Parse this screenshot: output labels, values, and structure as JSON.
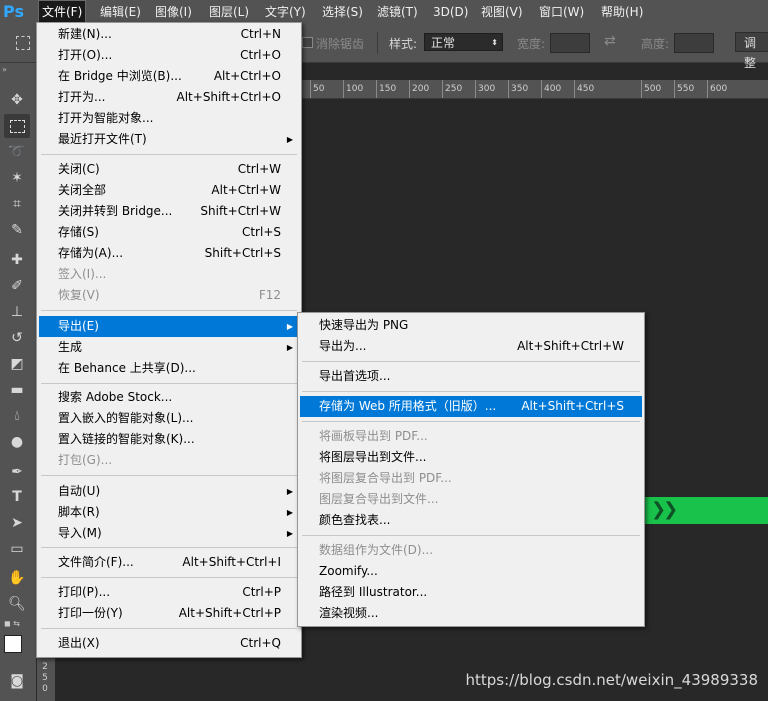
{
  "app": {
    "logo": "Ps",
    "menubar": [
      "文件(F)",
      "编辑(E)",
      "图像(I)",
      "图层(L)",
      "文字(Y)",
      "选择(S)",
      "滤镜(T)",
      "3D(D)",
      "视图(V)",
      "窗口(W)",
      "帮助(H)"
    ],
    "active_menu": "文件(F)"
  },
  "options": {
    "antialias_label": "消除锯齿",
    "style_label": "样式:",
    "style_value": "正常",
    "width_label": "宽度:",
    "height_label": "高度:",
    "adjust_button": "调整"
  },
  "ruler": {
    "ticks": [
      "50",
      "100",
      "150",
      "200",
      "250",
      "300",
      "350",
      "400",
      "450",
      "500",
      "550",
      "600"
    ],
    "vertical": [
      "2",
      "5",
      "0"
    ]
  },
  "file_menu": {
    "items": [
      {
        "label": "新建(N)...",
        "shortcut": "Ctrl+N"
      },
      {
        "label": "打开(O)...",
        "shortcut": "Ctrl+O"
      },
      {
        "label": "在 Bridge 中浏览(B)...",
        "shortcut": "Alt+Ctrl+O"
      },
      {
        "label": "打开为...",
        "shortcut": "Alt+Shift+Ctrl+O"
      },
      {
        "label": "打开为智能对象...",
        "shortcut": ""
      },
      {
        "label": "最近打开文件(T)",
        "shortcut": ""
      },
      {
        "label": "关闭(C)",
        "shortcut": "Ctrl+W"
      },
      {
        "label": "关闭全部",
        "shortcut": "Alt+Ctrl+W"
      },
      {
        "label": "关闭并转到 Bridge...",
        "shortcut": "Shift+Ctrl+W"
      },
      {
        "label": "存储(S)",
        "shortcut": "Ctrl+S"
      },
      {
        "label": "存储为(A)...",
        "shortcut": "Shift+Ctrl+S"
      },
      {
        "label": "签入(I)...",
        "shortcut": ""
      },
      {
        "label": "恢复(V)",
        "shortcut": "F12"
      },
      {
        "label": "导出(E)",
        "shortcut": ""
      },
      {
        "label": "生成",
        "shortcut": ""
      },
      {
        "label": "在 Behance 上共享(D)...",
        "shortcut": ""
      },
      {
        "label": "搜索 Adobe Stock...",
        "shortcut": ""
      },
      {
        "label": "置入嵌入的智能对象(L)...",
        "shortcut": ""
      },
      {
        "label": "置入链接的智能对象(K)...",
        "shortcut": ""
      },
      {
        "label": "打包(G)...",
        "shortcut": ""
      },
      {
        "label": "自动(U)",
        "shortcut": ""
      },
      {
        "label": "脚本(R)",
        "shortcut": ""
      },
      {
        "label": "导入(M)",
        "shortcut": ""
      },
      {
        "label": "文件简介(F)...",
        "shortcut": "Alt+Shift+Ctrl+I"
      },
      {
        "label": "打印(P)...",
        "shortcut": "Ctrl+P"
      },
      {
        "label": "打印一份(Y)",
        "shortcut": "Alt+Shift+Ctrl+P"
      },
      {
        "label": "退出(X)",
        "shortcut": "Ctrl+Q"
      }
    ]
  },
  "export_menu": {
    "items": [
      {
        "label": "快速导出为 PNG",
        "shortcut": ""
      },
      {
        "label": "导出为...",
        "shortcut": "Alt+Shift+Ctrl+W"
      },
      {
        "label": "导出首选项...",
        "shortcut": ""
      },
      {
        "label": "存储为 Web 所用格式（旧版）...",
        "shortcut": "Alt+Shift+Ctrl+S"
      },
      {
        "label": "将画板导出到 PDF...",
        "shortcut": ""
      },
      {
        "label": "将图层导出到文件...",
        "shortcut": ""
      },
      {
        "label": "将图层复合导出到 PDF...",
        "shortcut": ""
      },
      {
        "label": "图层复合导出到文件...",
        "shortcut": ""
      },
      {
        "label": "颜色查找表...",
        "shortcut": ""
      },
      {
        "label": "数据组作为文件(D)...",
        "shortcut": ""
      },
      {
        "label": "Zoomify...",
        "shortcut": ""
      },
      {
        "label": "路径到 Illustrator...",
        "shortcut": ""
      },
      {
        "label": "渲染视频...",
        "shortcut": ""
      }
    ]
  },
  "watermark": "https://blog.csdn.net/weixin_43989338",
  "colors": {
    "highlight": "#0078d7",
    "accent_green": "#19c24b"
  }
}
